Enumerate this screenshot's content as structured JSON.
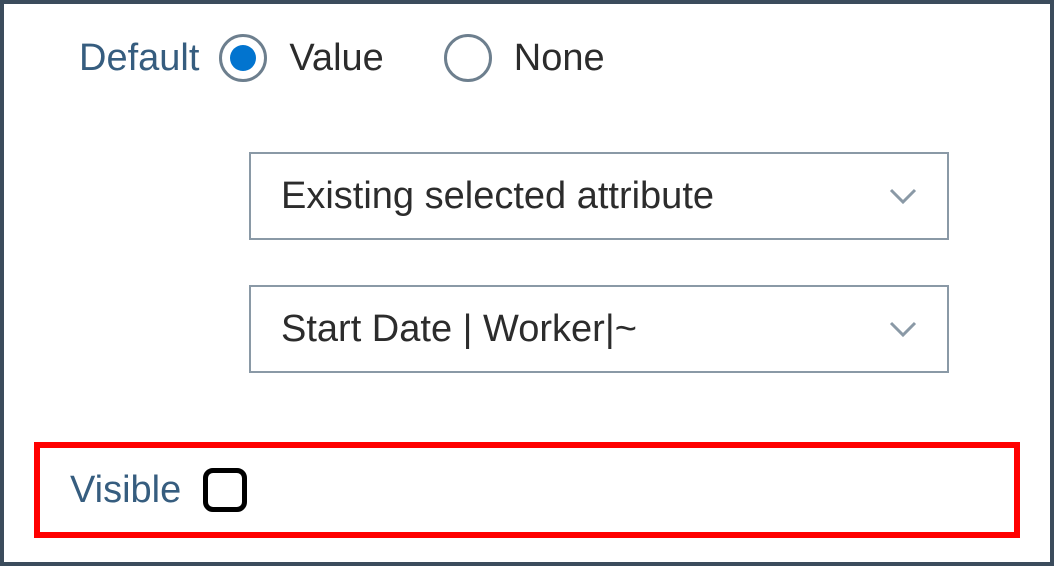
{
  "default": {
    "label": "Default",
    "options": [
      {
        "label": "Value",
        "selected": true
      },
      {
        "label": "None",
        "selected": false
      }
    ]
  },
  "dropdowns": {
    "attribute": "Existing selected attribute",
    "field": "Start Date | Worker|~"
  },
  "visible": {
    "label": "Visible",
    "checked": false
  }
}
